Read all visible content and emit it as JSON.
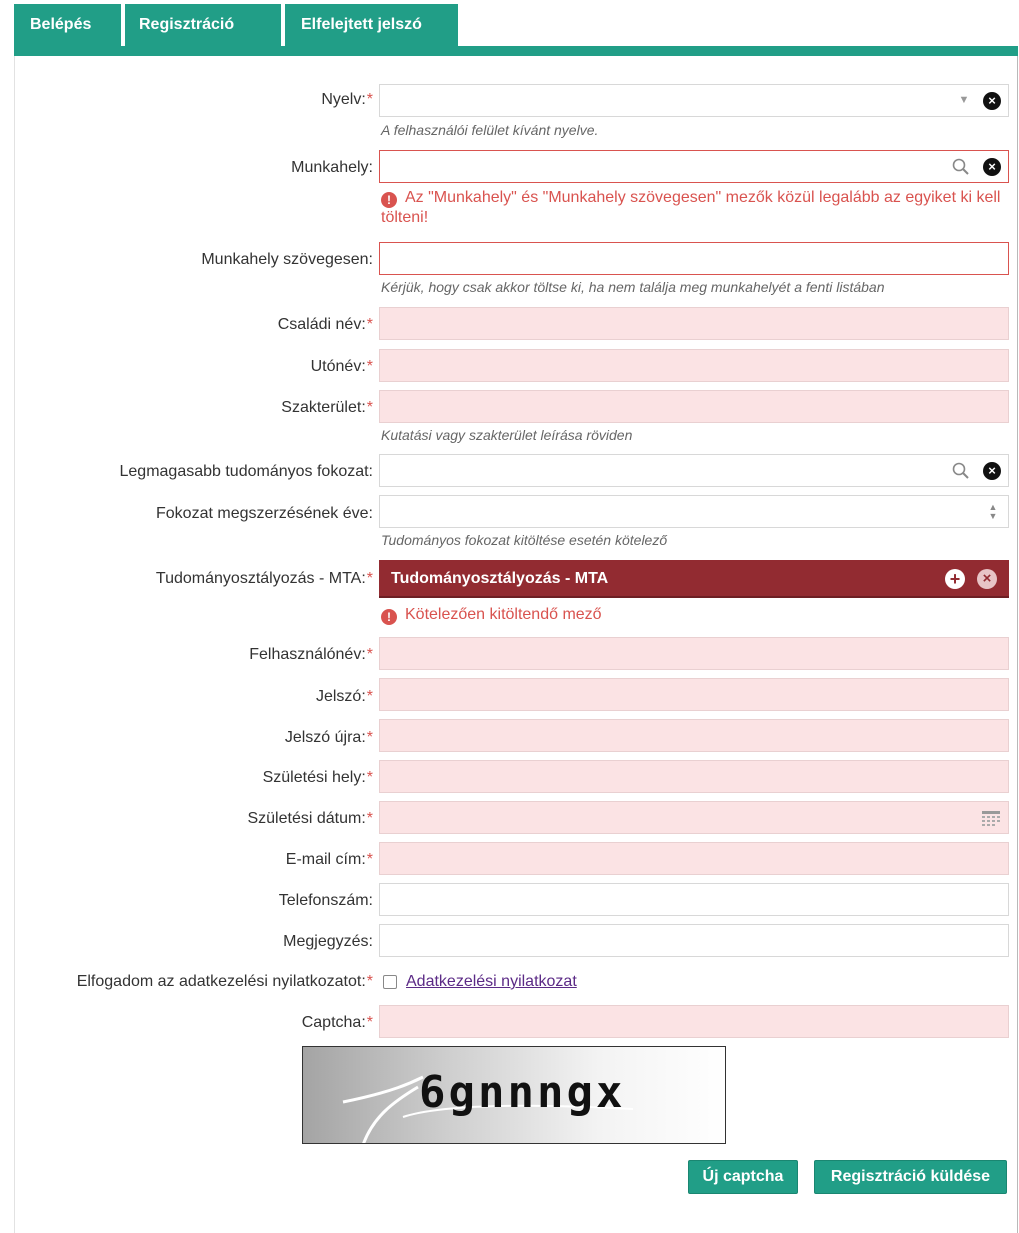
{
  "tabs": {
    "login": "Belépés",
    "register": "Regisztráció",
    "forgot": "Elfelejtett jelszó"
  },
  "form": {
    "language": {
      "label": "Nyelv:",
      "hint": "A felhasználói felület kívánt nyelve."
    },
    "workplace": {
      "label": "Munkahely:",
      "error": "Az \"Munkahely\" és \"Munkahely szövegesen\" mezők közül legalább az egyiket ki kell tölteni!"
    },
    "workplace_text": {
      "label": "Munkahely szövegesen:",
      "hint": "Kérjük, hogy csak akkor töltse ki, ha nem találja meg munkahelyét a fenti listában"
    },
    "family_name": {
      "label": "Családi név:"
    },
    "given_name": {
      "label": "Utónév:"
    },
    "field_of_expertise": {
      "label": "Szakterület:",
      "hint": "Kutatási vagy szakterület leírása röviden"
    },
    "degree": {
      "label": "Legmagasabb tudományos fokozat:"
    },
    "degree_year": {
      "label": "Fokozat megszerzésének éve:",
      "hint": "Tudományos fokozat kitöltése esetén kötelező"
    },
    "mta_section": {
      "label": "Tudományosztályozás - MTA:",
      "value": "Tudományosztályozás - MTA",
      "error": "Kötelezően kitöltendő mező"
    },
    "username": {
      "label": "Felhasználónév:"
    },
    "password": {
      "label": "Jelszó:"
    },
    "password_again": {
      "label": "Jelszó újra:"
    },
    "birth_place": {
      "label": "Születési hely:"
    },
    "birth_date": {
      "label": "Születési dátum:"
    },
    "email": {
      "label": "E-mail cím:"
    },
    "phone": {
      "label": "Telefonszám:"
    },
    "note": {
      "label": "Megjegyzés:"
    },
    "privacy": {
      "label": "Elfogadom az adatkezelési nyilatkozatot:",
      "link": "Adatkezelési nyilatkozat"
    },
    "captcha": {
      "label": "Captcha:",
      "text": "6gnnngx"
    },
    "required_mark": "*"
  },
  "buttons": {
    "new_captcha": "Új captcha",
    "submit": "Regisztráció küldése"
  },
  "colors": {
    "accent": "#219e87",
    "error": "#d9534f",
    "required_bg": "#fbe3e4",
    "mta_bg": "#922b31"
  },
  "icons": [
    "search-icon",
    "close-icon",
    "chevron-down-icon",
    "spinner-icon",
    "calendar-icon",
    "plus-circle-icon",
    "exclamation-icon"
  ]
}
